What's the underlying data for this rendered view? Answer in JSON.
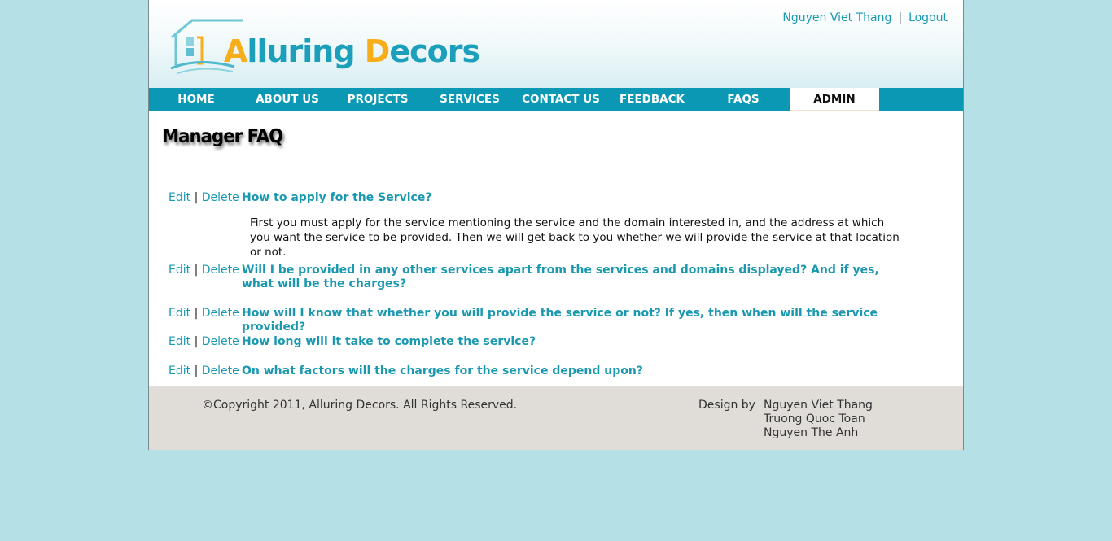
{
  "header": {
    "logo_cap1": "A",
    "logo_rest1": "lluring ",
    "logo_cap2": "D",
    "logo_rest2": "ecors",
    "user_name": "Nguyen Viet Thang",
    "separator": "|",
    "logout": "Logout"
  },
  "nav": {
    "items": [
      {
        "label": "HOME"
      },
      {
        "label": "ABOUT US"
      },
      {
        "label": "PROJECTS"
      },
      {
        "label": "SERVICES"
      },
      {
        "label": "CONTACT US"
      },
      {
        "label": "FEEDBACK"
      },
      {
        "label": "FAQS"
      },
      {
        "label": "ADMIN",
        "active": true
      }
    ]
  },
  "main": {
    "title": "Manager FAQ",
    "edit_label": "Edit",
    "action_sep": "|",
    "delete_label": "Delete",
    "faqs": [
      {
        "question": "How to apply for the Service?",
        "answer": "First you must apply for the service mentioning the service and the domain interested in, and the address at which you want the service to be provided. Then we will get back to you whether we will provide the service at that location or not."
      },
      {
        "question": "Will I be provided in any other services apart from the services and domains displayed? And if yes, what will be the charges?"
      },
      {
        "question": "How will I know that whether you will provide the service or not? If yes, then when will the service provided?"
      },
      {
        "question": "How long will it take to complete the service?"
      },
      {
        "question": "On what factors will the charges for the service depend upon?"
      }
    ]
  },
  "footer": {
    "copyright": "©Copyright 2011, Alluring Decors. All Rights Reserved.",
    "design_by": "Design by",
    "designers": [
      "Nguyen Viet Thang",
      "Truong Quoc Toan",
      "Nguyen The Anh"
    ]
  },
  "colors": {
    "background": "#b4e0e6",
    "nav": "#0b98b4",
    "link": "#1a98b0",
    "logo_orange": "#f6ae1b",
    "logo_teal": "#1c9fbb",
    "footer": "#e0dcd8"
  }
}
